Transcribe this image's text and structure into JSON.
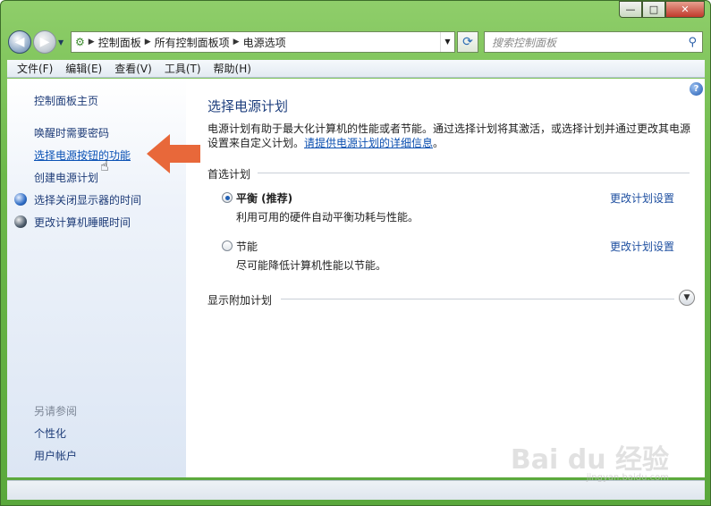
{
  "title_bar": {
    "minimize": "—",
    "maximize": "□",
    "close": "✕"
  },
  "address_bar": {
    "breadcrumbs": [
      "控制面板",
      "所有控制面板项",
      "电源选项"
    ],
    "search_placeholder": "搜索控制面板"
  },
  "menu": [
    "文件(F)",
    "编辑(E)",
    "查看(V)",
    "工具(T)",
    "帮助(H)"
  ],
  "sidebar": {
    "home": "控制面板主页",
    "items": [
      {
        "label": "唤醒时需要密码",
        "icon": null
      },
      {
        "label": "选择电源按钮的功能",
        "icon": null
      },
      {
        "label": "创建电源计划",
        "icon": null
      },
      {
        "label": "选择关闭显示器的时间",
        "icon": "monitor-icon"
      },
      {
        "label": "更改计算机睡眠时间",
        "icon": "moon-icon"
      }
    ],
    "see_also_heading": "另请参阅",
    "see_also": [
      "个性化",
      "用户帐户"
    ]
  },
  "main": {
    "title": "选择电源计划",
    "description": "电源计划有助于最大化计算机的性能或者节能。通过选择计划将其激活，或选择计划并通过更改其电源设置来自定义计划。",
    "description_link": "请提供电源计划的详细信息",
    "description_end": "。",
    "preferred_heading": "首选计划",
    "plans": [
      {
        "name": "平衡 (推荐)",
        "desc": "利用可用的硬件自动平衡功耗与性能。",
        "link": "更改计划设置",
        "selected": true
      },
      {
        "name": "节能",
        "desc": "尽可能降低计算机性能以节能。",
        "link": "更改计划设置",
        "selected": false
      }
    ],
    "additional_heading": "显示附加计划",
    "help": "?"
  },
  "watermark": {
    "main": "Bai du 经验",
    "sub": "jingyan.baidu.com"
  },
  "colors": {
    "accent_arrow": "#e8683a",
    "link": "#0b52b5",
    "title": "#1d3e7d"
  }
}
